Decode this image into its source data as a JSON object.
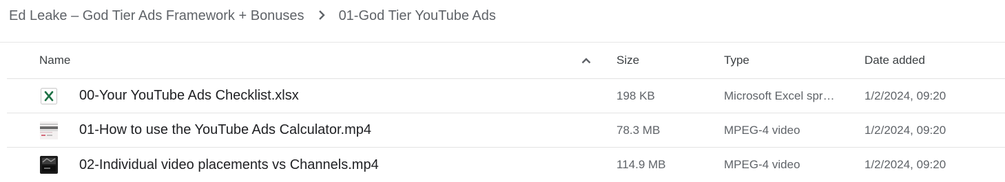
{
  "breadcrumb": {
    "parent": "Ed Leake – God Tier Ads Framework + Bonuses",
    "current": "01-God Tier YouTube Ads"
  },
  "table": {
    "headers": {
      "name": "Name",
      "size": "Size",
      "type": "Type",
      "date": "Date added"
    },
    "sort_icon": "chevron-up-icon",
    "rows": [
      {
        "icon": "excel-file-icon",
        "name": "00-Your YouTube Ads Checklist.xlsx",
        "size": "198 KB",
        "type": "Microsoft Excel spr…",
        "date": "1/2/2024, 09:20"
      },
      {
        "icon": "video-thumbnail-icon",
        "name": "01-How to use the YouTube Ads Calculator.mp4",
        "size": "78.3 MB",
        "type": "MPEG-4 video",
        "date": "1/2/2024, 09:20"
      },
      {
        "icon": "video-thumbnail-icon",
        "name": "02-Individual video placements vs Channels.mp4",
        "size": "114.9 MB",
        "type": "MPEG-4 video",
        "date": "1/2/2024, 09:20"
      }
    ]
  },
  "colors": {
    "excel_green": "#1e7145",
    "divider": "#e3e3e3",
    "text_secondary": "#5f6368"
  }
}
